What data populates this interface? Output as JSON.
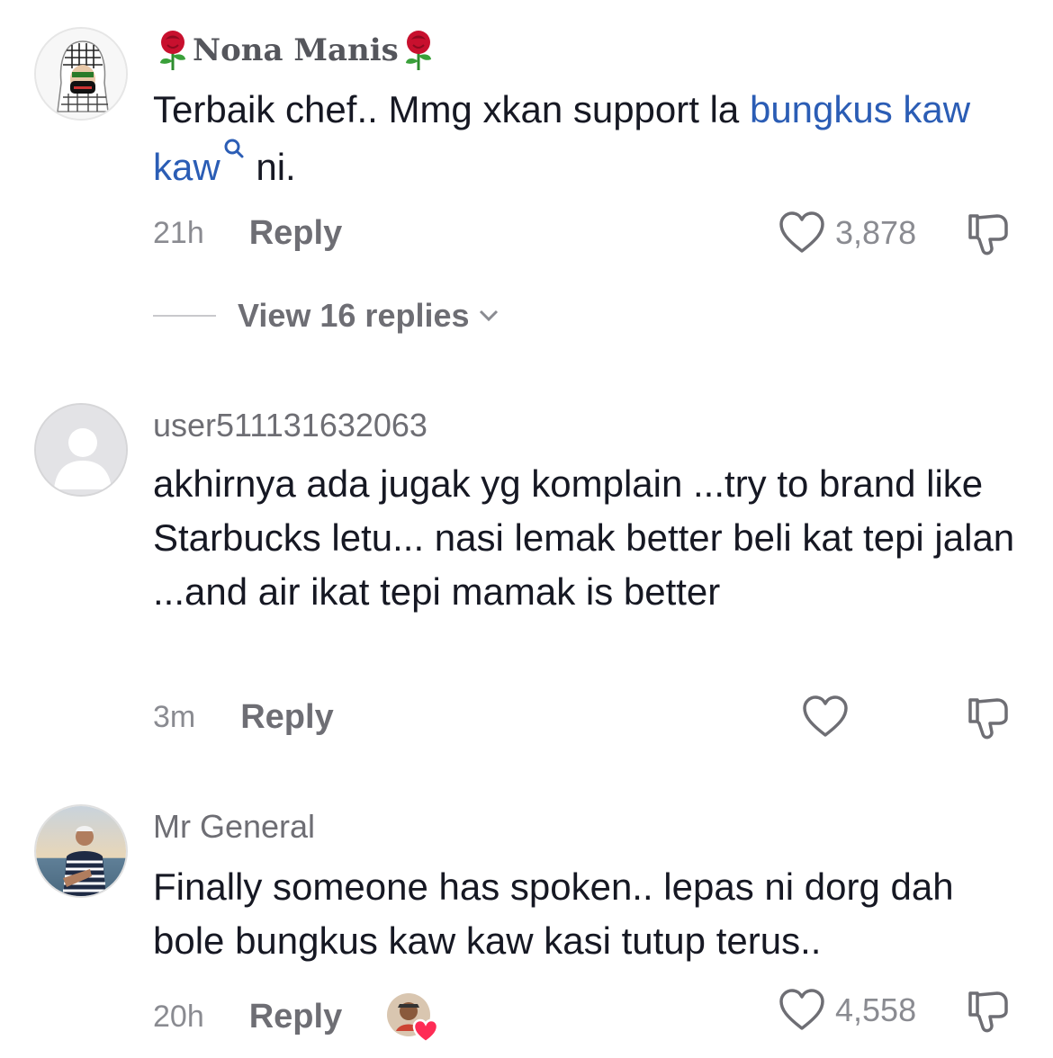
{
  "comments": [
    {
      "username": "Nona Manis",
      "text_pre": "Terbaik chef.. Mmg xkan support la ",
      "text_link": "bungkus kaw kaw",
      "text_post": " ni.",
      "time": "21h",
      "reply_label": "Reply",
      "likes": "3,878",
      "view_replies": "View 16 replies"
    },
    {
      "username": "user511131632063",
      "text": "akhirnya ada jugak yg komplain ...try to brand like Starbucks letu... nasi lemak better beli kat tepi jalan ...and air ikat tepi mamak is better",
      "time": "3m",
      "reply_label": "Reply",
      "likes": ""
    },
    {
      "username": "Mr General",
      "text": "Finally someone has spoken.. lepas ni dorg dah bole bungkus kaw kaw kasi tutup terus..",
      "time": "20h",
      "reply_label": "Reply",
      "likes": "4,558"
    }
  ],
  "icons": {
    "like": "heart-outline-icon",
    "dislike": "thumbs-down-icon",
    "search": "search-icon",
    "chevron": "chevron-down-icon",
    "rose": "rose-emoji"
  },
  "colors": {
    "link": "#2b5db5",
    "muted": "#8a8b91",
    "text": "#161823",
    "creator_heart": "#fe2c55"
  }
}
